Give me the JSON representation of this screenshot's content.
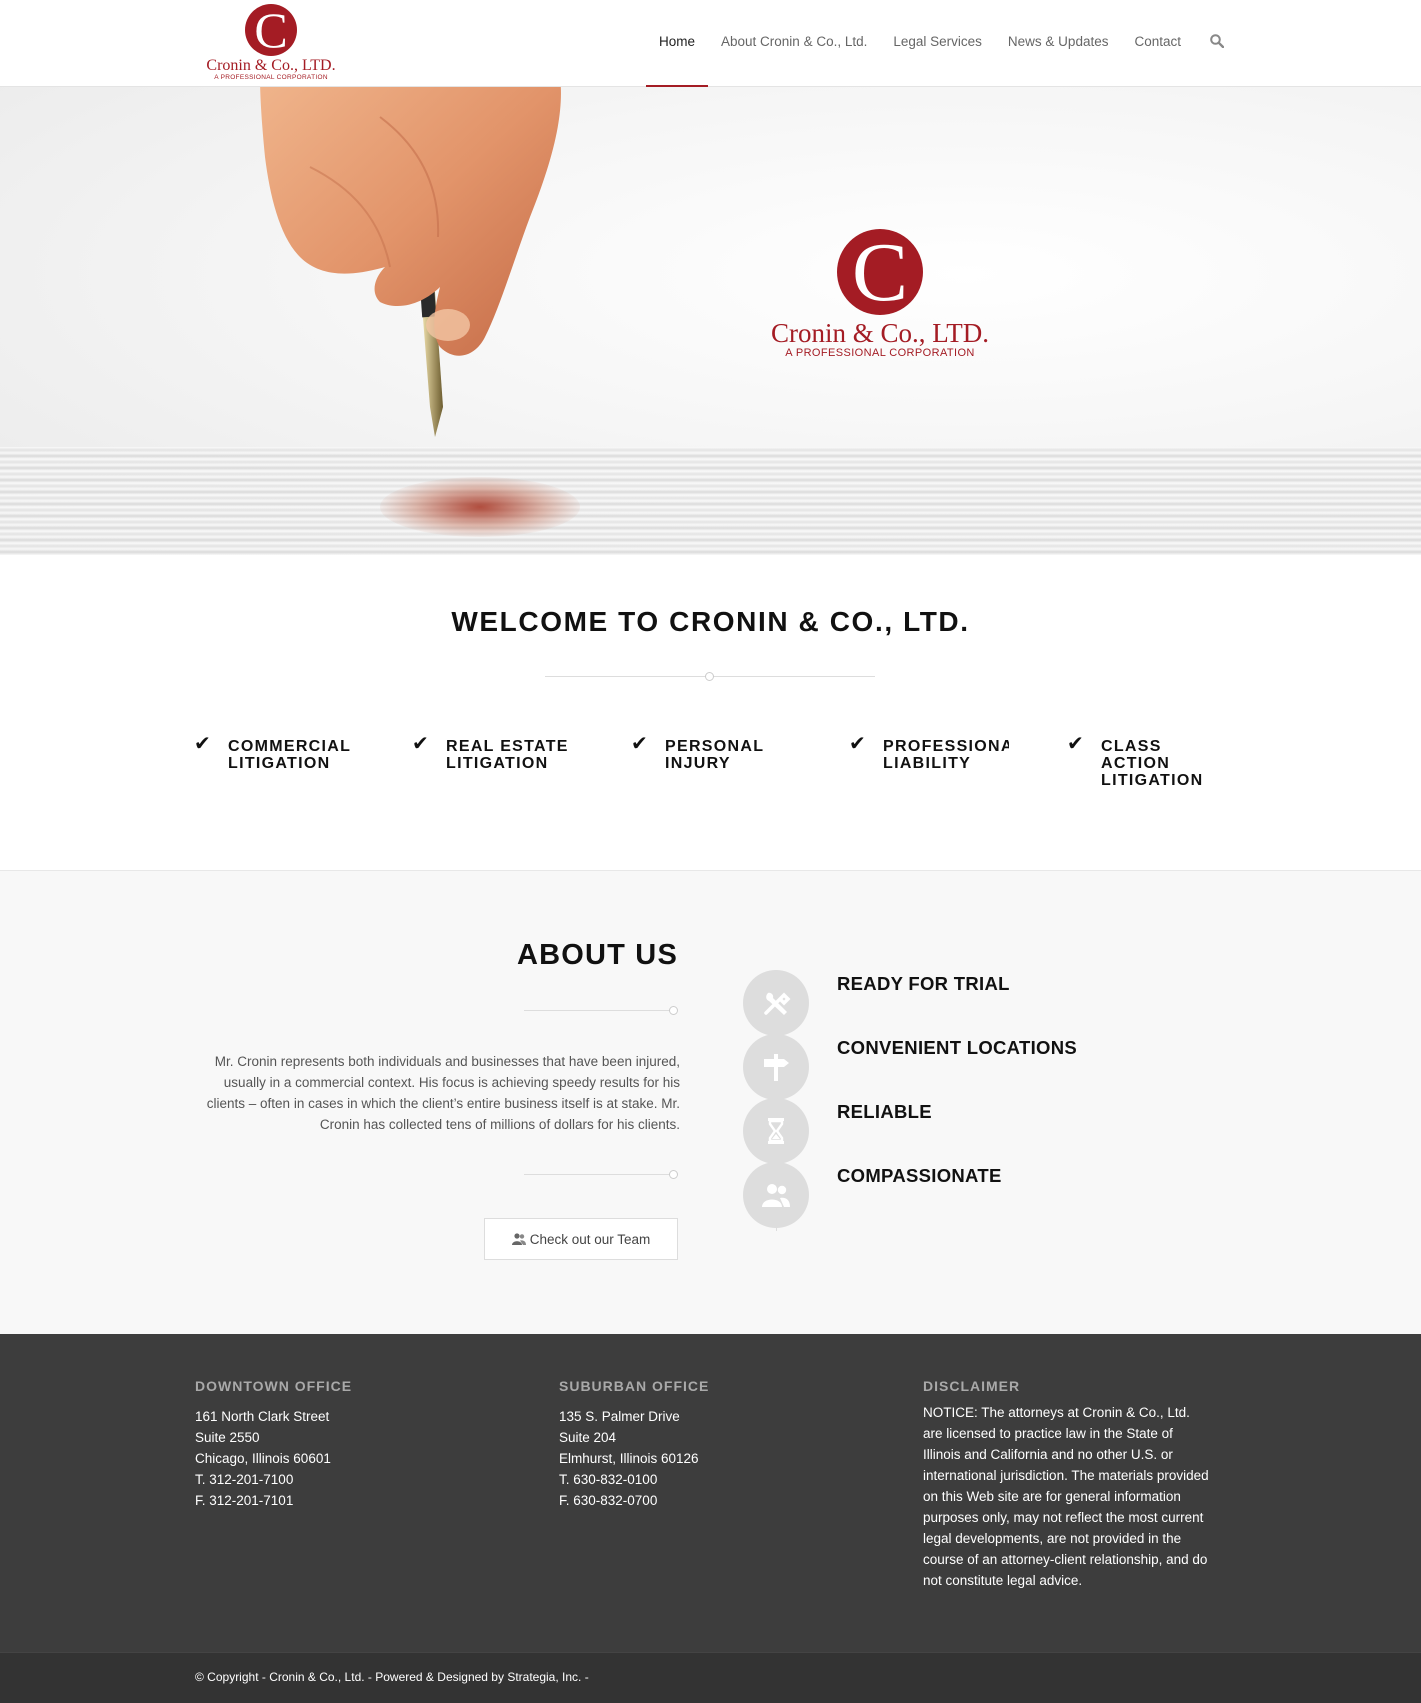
{
  "header": {
    "logo": {
      "letter": "C",
      "name": "Cronin & Co., LTD.",
      "sub": "A PROFESSIONAL CORPORATION"
    },
    "nav": [
      {
        "label": "Home"
      },
      {
        "label": "About Cronin & Co., Ltd."
      },
      {
        "label": "Legal Services"
      },
      {
        "label": "News & Updates"
      },
      {
        "label": "Contact"
      }
    ],
    "active_nav": "Home",
    "search_icon": "search-icon"
  },
  "hero": {
    "logo": {
      "letter": "C",
      "name": "Cronin & Co., LTD.",
      "sub": "A PROFESSIONAL CORPORATION"
    }
  },
  "welcome": {
    "title": "WELCOME TO CRONIN & CO., LTD.",
    "services": [
      {
        "line1": "COMMERCIAL",
        "line2": "LITIGATION",
        "line3": ""
      },
      {
        "line1": "REAL ESTATE",
        "line2": "LITIGATION",
        "line3": ""
      },
      {
        "line1": "PERSONAL",
        "line2": "INJURY",
        "line3": ""
      },
      {
        "line1": "PROFESSIONAL",
        "line2": "LIABILITY",
        "line3": ""
      },
      {
        "line1": "CLASS",
        "line2": "ACTION",
        "line3": "LITIGATION"
      }
    ],
    "check_icon": "checkmark-icon"
  },
  "about": {
    "title": "ABOUT US",
    "text": "Mr. Cronin represents both individuals and businesses that have been injured, usually in a commercial context. His focus is achieving speedy results for his clients – often in cases in which the client’s entire business itself is at stake. Mr. Cronin has collected tens of millions of dollars for his clients.",
    "button_label": "Check out our Team",
    "features": [
      {
        "label": "READY FOR TRIAL",
        "icon": "tools-icon"
      },
      {
        "label": "CONVENIENT LOCATIONS",
        "icon": "signpost-icon"
      },
      {
        "label": "RELIABLE",
        "icon": "hourglass-icon"
      },
      {
        "label": "COMPASSIONATE",
        "icon": "users-icon"
      }
    ]
  },
  "footer": {
    "downtown": {
      "title": "DOWNTOWN OFFICE",
      "lines": [
        "161 North Clark Street",
        "Suite 2550",
        "Chicago, Illinois 60601",
        "T. 312-201-7100",
        "F. 312-201-7101"
      ]
    },
    "suburban": {
      "title": "SUBURBAN OFFICE",
      "lines": [
        "135 S. Palmer Drive",
        "Suite 204",
        "Elmhurst, Illinois 60126",
        "T. 630-832-0100",
        "F. 630-832-0700"
      ]
    },
    "disclaimer": {
      "title": "DISCLAIMER",
      "text": "NOTICE: The attorneys at Cronin & Co., Ltd. are licensed to practice law in the State of Illinois and California and no other U.S. or international jurisdiction. The materials provided on this Web site are for general information purposes only, may not reflect the most current legal developments, are not provided in the course of an attorney-client relationship, and do not constitute legal advice."
    },
    "copyright": "© Copyright - Cronin & Co., Ltd. - Powered & Designed by Strategia, Inc. -"
  },
  "colors": {
    "brand": "#a41c24",
    "footer": "#3d3d3d",
    "socket": "#333333"
  }
}
